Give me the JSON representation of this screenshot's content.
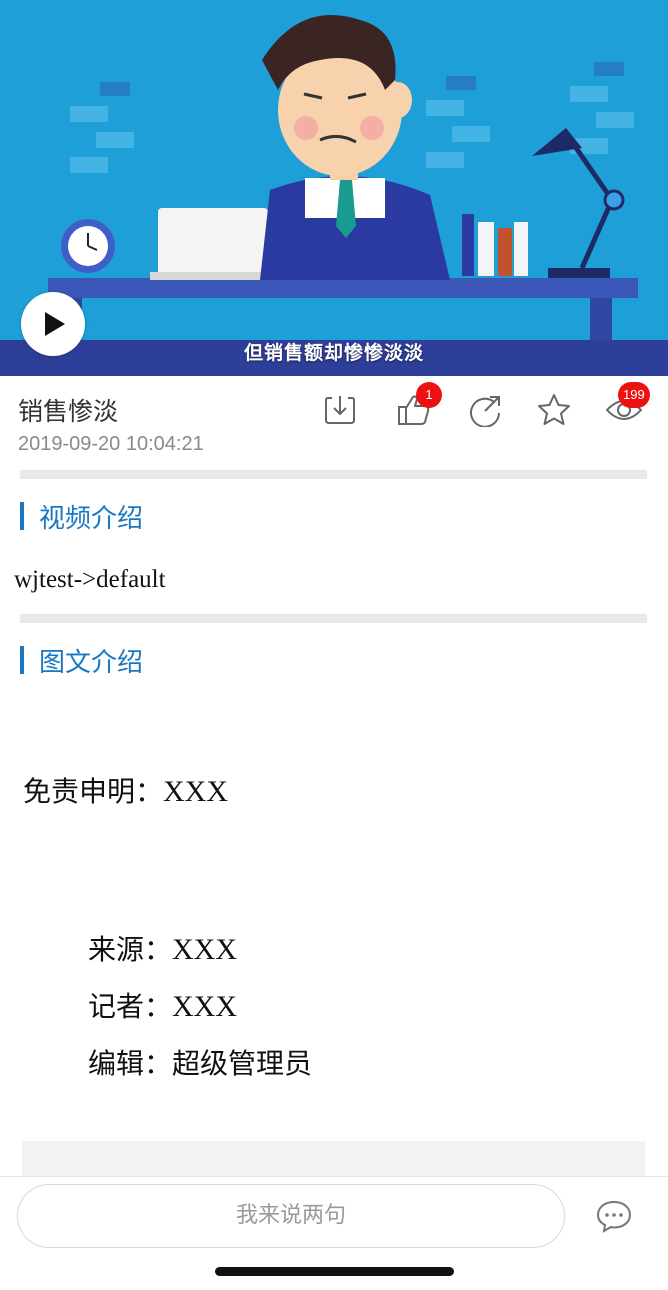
{
  "video": {
    "subtitle": "但销售额却惨惨淡淡",
    "play_icon": "play-icon"
  },
  "info": {
    "title": "销售惨淡",
    "timestamp": "2019-09-20 10:04:21",
    "actions": {
      "download_icon": "download-icon",
      "like_icon": "thumbs-up-icon",
      "like_count": "1",
      "share_icon": "share-icon",
      "favorite_icon": "star-icon",
      "view_icon": "eye-icon",
      "view_count": "199"
    }
  },
  "sections": {
    "video_intro": "视频介绍",
    "video_desc": "wjtest->default",
    "graphic_intro": "图文介绍"
  },
  "article": {
    "disclaimer_label": "免责申明：",
    "disclaimer_value": "XXX",
    "source_label": "来源：",
    "source_value": "XXX",
    "reporter_label": "记者：",
    "reporter_value": "XXX",
    "editor_label": "编辑：",
    "editor_value": "超级管理员"
  },
  "bottom": {
    "comment_placeholder": "我来说两句",
    "comment_icon": "comment-bubble-icon"
  },
  "colors": {
    "accent": "#1a78c2",
    "badge": "#ee1111",
    "video_bg": "#1f9fd8"
  }
}
